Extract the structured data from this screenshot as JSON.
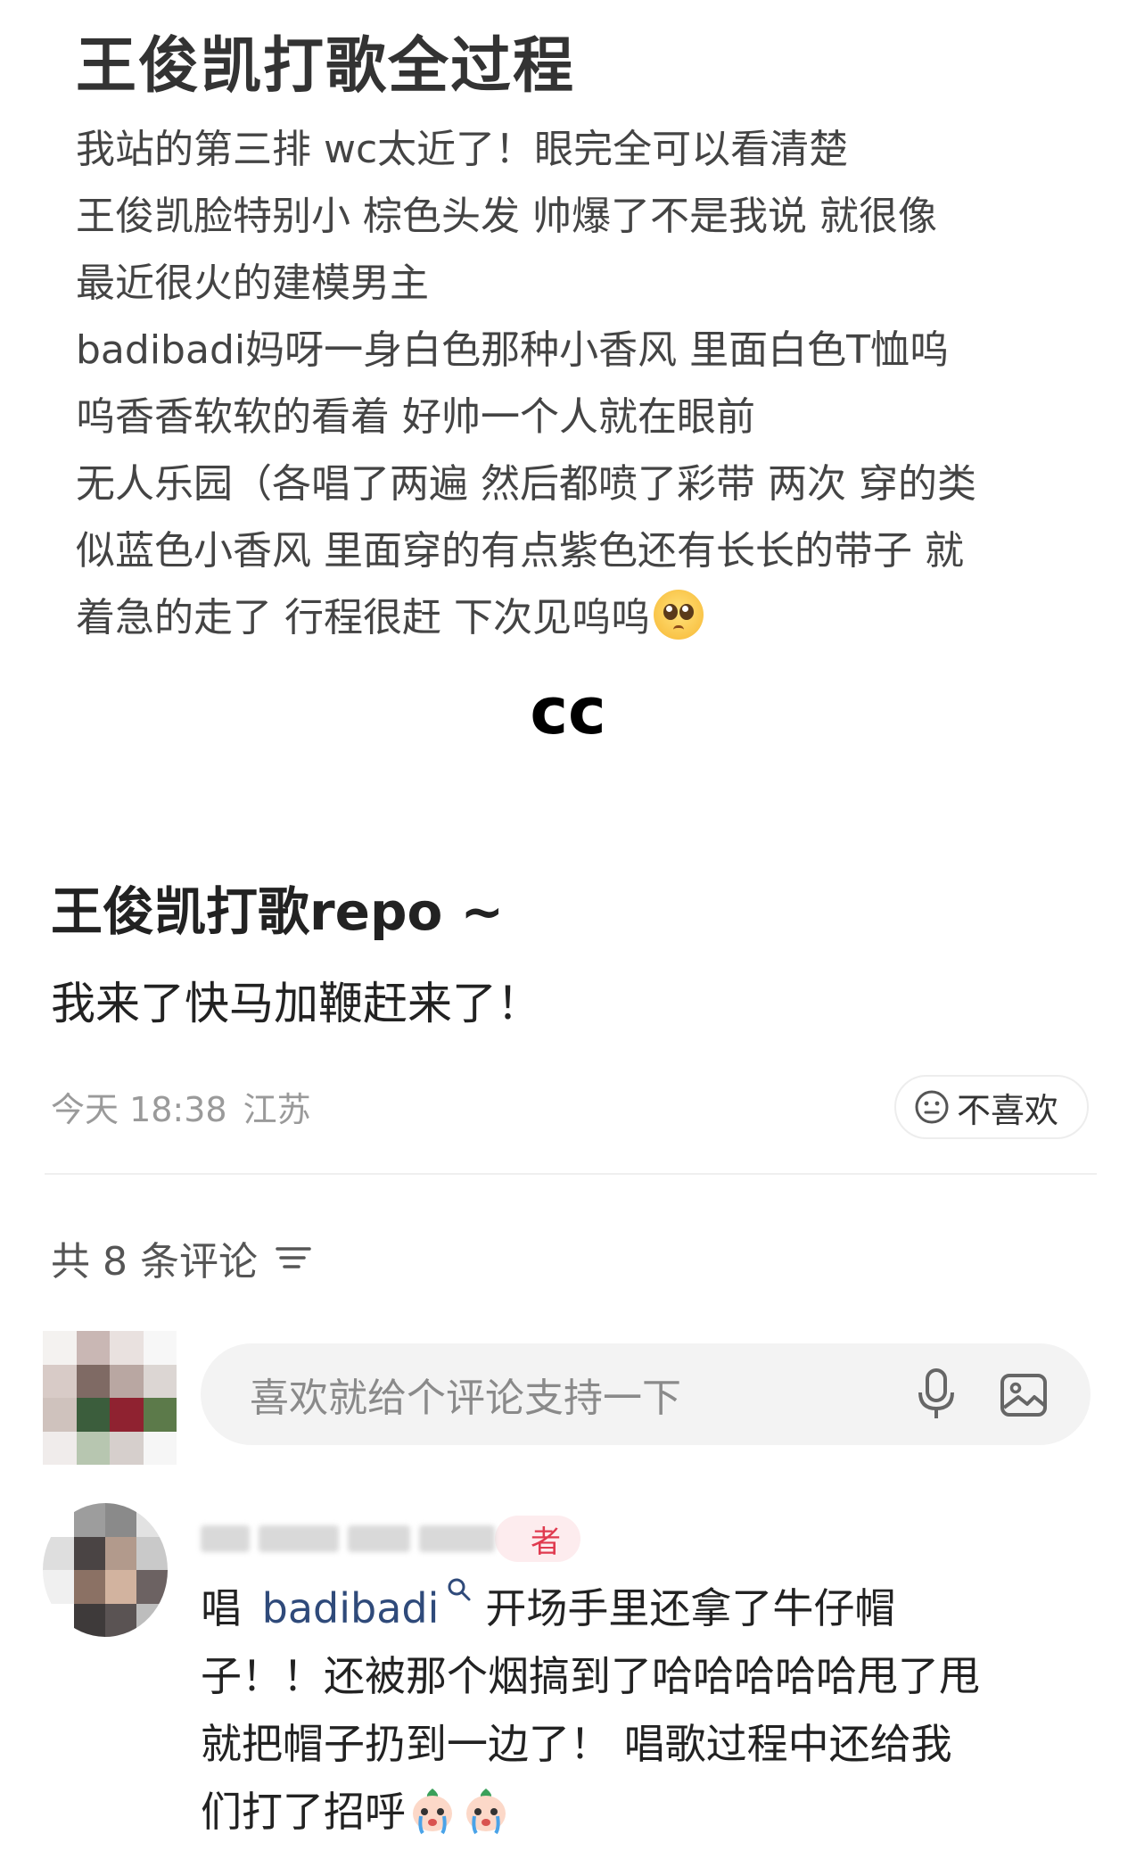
{
  "top_post": {
    "title": "王俊凯打歌全过程",
    "lines": [
      "我站的第三排 wc太近了！眼完全可以看清楚",
      "王俊凯脸特别小 棕色头发 帅爆了不是我说 就很像",
      "最近很火的建模男主",
      "badibadi妈呀一身白色那种小香风 里面白色T恤呜",
      "呜香香软软的看着 好帅一个人就在眼前",
      "无人乐园（各唱了两遍 然后都喷了彩带 两次 穿的类",
      "似蓝色小香风 里面穿的有点紫色还有长长的带子 就",
      "着急的走了 行程很赶 下次见呜呜"
    ],
    "emoji": "pleading-face"
  },
  "watermark": "cc",
  "post": {
    "title": "王俊凯打歌repo ~",
    "text": "我来了快马加鞭赶来了！",
    "date": "今天 18:38",
    "location": "江苏",
    "dislike_label": "不喜欢"
  },
  "comments": {
    "count_label": "共 8 条评论",
    "input_placeholder": "喜欢就给个评论支持一下",
    "items": [
      {
        "author_badge": "者",
        "line1_before": "唱",
        "mention": "badibadi",
        "line1_after": "开场手里还拿了牛仔帽",
        "line2": "子！！还被那个烟搞到了哈哈哈哈哈甩了甩",
        "line3": "就把帽子扔到一边了！ 唱歌过程中还给我",
        "line4": "们打了招呼"
      }
    ]
  },
  "icons": {
    "dislike": "neutral-face-icon",
    "sort": "sort-lines-icon",
    "mic": "microphone-icon",
    "image": "image-icon",
    "mention_search": "search-icon",
    "sticker": "crying-sticker"
  },
  "colors": {
    "badge_text": "#e03a4f",
    "badge_bg": "#fdecee",
    "mention": "#2f4a7a",
    "meta": "#9a9a9a"
  }
}
